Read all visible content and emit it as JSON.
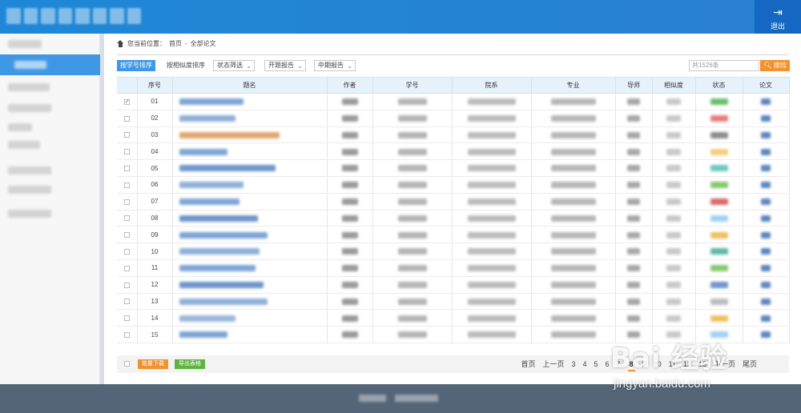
{
  "header": {
    "logout_icon": "logout-icon",
    "logout_label": "退出"
  },
  "breadcrumb": {
    "prefix": "您当前位置：",
    "home": "首页",
    "sep": " - ",
    "current": "全部论文"
  },
  "toolbar": {
    "sort_by_id": "按学号排序",
    "sort_by_similarity": "按相似度排序",
    "filter_status": "状态筛选",
    "filter_proposal": "开题报告",
    "filter_midterm": "中期报告",
    "search_placeholder": "共1526条",
    "search_label": "搜找"
  },
  "table": {
    "columns": [
      "序号",
      "题名",
      "作者",
      "学号",
      "院系",
      "专业",
      "导师",
      "相似度",
      "状态",
      "论文"
    ],
    "rows": [
      {
        "no": "01",
        "checked": true
      },
      {
        "no": "02",
        "checked": false
      },
      {
        "no": "03",
        "checked": false
      },
      {
        "no": "04",
        "checked": false
      },
      {
        "no": "05",
        "checked": false
      },
      {
        "no": "06",
        "checked": false
      },
      {
        "no": "07",
        "checked": false
      },
      {
        "no": "08",
        "checked": false
      },
      {
        "no": "09",
        "checked": false
      },
      {
        "no": "10",
        "checked": false
      },
      {
        "no": "11",
        "checked": false
      },
      {
        "no": "12",
        "checked": false
      },
      {
        "no": "13",
        "checked": false
      },
      {
        "no": "14",
        "checked": false
      },
      {
        "no": "15",
        "checked": false
      }
    ]
  },
  "footer": {
    "batch_download": "批量下载",
    "export_table": "导出表格",
    "pager": {
      "first": "首页",
      "prev": "上一页",
      "pages": [
        "3",
        "4",
        "5",
        "6",
        "7",
        "8",
        "9",
        "10",
        "11",
        "12",
        "13"
      ],
      "current": "8",
      "next": "下一页",
      "last": "尾页"
    }
  },
  "watermark": {
    "main": "Bai 经验",
    "sub": "jingyan.baidu.com"
  },
  "colors": {
    "primary": "#3f98e6",
    "header": "#1e88d8",
    "orange": "#f0922e",
    "green": "#5fb43f",
    "footer": "#546577"
  }
}
